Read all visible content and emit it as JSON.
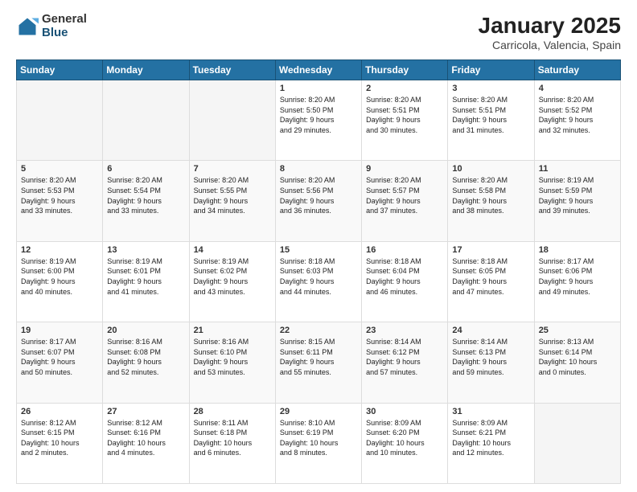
{
  "header": {
    "logo": {
      "general": "General",
      "blue": "Blue"
    },
    "title": "January 2025",
    "subtitle": "Carricola, Valencia, Spain"
  },
  "calendar": {
    "days": [
      "Sunday",
      "Monday",
      "Tuesday",
      "Wednesday",
      "Thursday",
      "Friday",
      "Saturday"
    ],
    "weeks": [
      [
        {
          "day": "",
          "content": ""
        },
        {
          "day": "",
          "content": ""
        },
        {
          "day": "",
          "content": ""
        },
        {
          "day": "1",
          "content": "Sunrise: 8:20 AM\nSunset: 5:50 PM\nDaylight: 9 hours\nand 29 minutes."
        },
        {
          "day": "2",
          "content": "Sunrise: 8:20 AM\nSunset: 5:51 PM\nDaylight: 9 hours\nand 30 minutes."
        },
        {
          "day": "3",
          "content": "Sunrise: 8:20 AM\nSunset: 5:51 PM\nDaylight: 9 hours\nand 31 minutes."
        },
        {
          "day": "4",
          "content": "Sunrise: 8:20 AM\nSunset: 5:52 PM\nDaylight: 9 hours\nand 32 minutes."
        }
      ],
      [
        {
          "day": "5",
          "content": "Sunrise: 8:20 AM\nSunset: 5:53 PM\nDaylight: 9 hours\nand 33 minutes."
        },
        {
          "day": "6",
          "content": "Sunrise: 8:20 AM\nSunset: 5:54 PM\nDaylight: 9 hours\nand 33 minutes."
        },
        {
          "day": "7",
          "content": "Sunrise: 8:20 AM\nSunset: 5:55 PM\nDaylight: 9 hours\nand 34 minutes."
        },
        {
          "day": "8",
          "content": "Sunrise: 8:20 AM\nSunset: 5:56 PM\nDaylight: 9 hours\nand 36 minutes."
        },
        {
          "day": "9",
          "content": "Sunrise: 8:20 AM\nSunset: 5:57 PM\nDaylight: 9 hours\nand 37 minutes."
        },
        {
          "day": "10",
          "content": "Sunrise: 8:20 AM\nSunset: 5:58 PM\nDaylight: 9 hours\nand 38 minutes."
        },
        {
          "day": "11",
          "content": "Sunrise: 8:19 AM\nSunset: 5:59 PM\nDaylight: 9 hours\nand 39 minutes."
        }
      ],
      [
        {
          "day": "12",
          "content": "Sunrise: 8:19 AM\nSunset: 6:00 PM\nDaylight: 9 hours\nand 40 minutes."
        },
        {
          "day": "13",
          "content": "Sunrise: 8:19 AM\nSunset: 6:01 PM\nDaylight: 9 hours\nand 41 minutes."
        },
        {
          "day": "14",
          "content": "Sunrise: 8:19 AM\nSunset: 6:02 PM\nDaylight: 9 hours\nand 43 minutes."
        },
        {
          "day": "15",
          "content": "Sunrise: 8:18 AM\nSunset: 6:03 PM\nDaylight: 9 hours\nand 44 minutes."
        },
        {
          "day": "16",
          "content": "Sunrise: 8:18 AM\nSunset: 6:04 PM\nDaylight: 9 hours\nand 46 minutes."
        },
        {
          "day": "17",
          "content": "Sunrise: 8:18 AM\nSunset: 6:05 PM\nDaylight: 9 hours\nand 47 minutes."
        },
        {
          "day": "18",
          "content": "Sunrise: 8:17 AM\nSunset: 6:06 PM\nDaylight: 9 hours\nand 49 minutes."
        }
      ],
      [
        {
          "day": "19",
          "content": "Sunrise: 8:17 AM\nSunset: 6:07 PM\nDaylight: 9 hours\nand 50 minutes."
        },
        {
          "day": "20",
          "content": "Sunrise: 8:16 AM\nSunset: 6:08 PM\nDaylight: 9 hours\nand 52 minutes."
        },
        {
          "day": "21",
          "content": "Sunrise: 8:16 AM\nSunset: 6:10 PM\nDaylight: 9 hours\nand 53 minutes."
        },
        {
          "day": "22",
          "content": "Sunrise: 8:15 AM\nSunset: 6:11 PM\nDaylight: 9 hours\nand 55 minutes."
        },
        {
          "day": "23",
          "content": "Sunrise: 8:14 AM\nSunset: 6:12 PM\nDaylight: 9 hours\nand 57 minutes."
        },
        {
          "day": "24",
          "content": "Sunrise: 8:14 AM\nSunset: 6:13 PM\nDaylight: 9 hours\nand 59 minutes."
        },
        {
          "day": "25",
          "content": "Sunrise: 8:13 AM\nSunset: 6:14 PM\nDaylight: 10 hours\nand 0 minutes."
        }
      ],
      [
        {
          "day": "26",
          "content": "Sunrise: 8:12 AM\nSunset: 6:15 PM\nDaylight: 10 hours\nand 2 minutes."
        },
        {
          "day": "27",
          "content": "Sunrise: 8:12 AM\nSunset: 6:16 PM\nDaylight: 10 hours\nand 4 minutes."
        },
        {
          "day": "28",
          "content": "Sunrise: 8:11 AM\nSunset: 6:18 PM\nDaylight: 10 hours\nand 6 minutes."
        },
        {
          "day": "29",
          "content": "Sunrise: 8:10 AM\nSunset: 6:19 PM\nDaylight: 10 hours\nand 8 minutes."
        },
        {
          "day": "30",
          "content": "Sunrise: 8:09 AM\nSunset: 6:20 PM\nDaylight: 10 hours\nand 10 minutes."
        },
        {
          "day": "31",
          "content": "Sunrise: 8:09 AM\nSunset: 6:21 PM\nDaylight: 10 hours\nand 12 minutes."
        },
        {
          "day": "",
          "content": ""
        }
      ]
    ]
  }
}
